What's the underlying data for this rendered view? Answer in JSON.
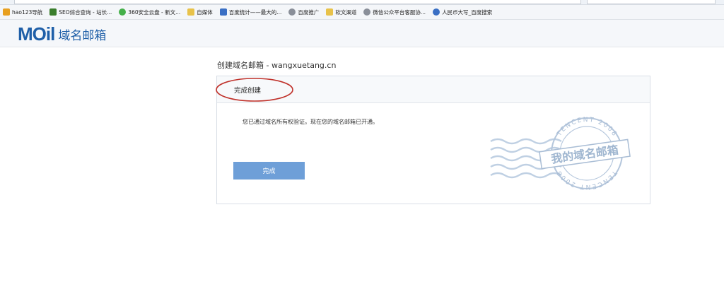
{
  "bookmarks": [
    {
      "label": "hao123导航",
      "icon": "hao123-icon",
      "color": "#e8a020"
    },
    {
      "label": "SEO综合查询 - 站长...",
      "icon": "seo-icon",
      "color": "#3a7d2c"
    },
    {
      "label": "360安全云盘 - 新文...",
      "icon": "cloud-icon",
      "color": "#45b04a"
    },
    {
      "label": "自媒体",
      "icon": "folder-icon",
      "color": "#e8c24a"
    },
    {
      "label": "百度统计——最大的...",
      "icon": "stats-icon",
      "color": "#3a6fc4"
    },
    {
      "label": "百度推广",
      "icon": "globe-icon",
      "color": "#8a8f99"
    },
    {
      "label": "软文渠道",
      "icon": "folder-icon",
      "color": "#e8c24a"
    },
    {
      "label": "微信公众平台客服协...",
      "icon": "globe-icon",
      "color": "#8a8f99"
    },
    {
      "label": "人民币大写_百度搜索",
      "icon": "paw-icon",
      "color": "#3a6fc4"
    }
  ],
  "header": {
    "logo_mark": "MOil",
    "logo_text": "域名邮箱"
  },
  "page": {
    "title": "创建域名邮箱 - wangxuetang.cn"
  },
  "card": {
    "header_title": "完成创建",
    "message": "您已通过域名所有权验证。现在您的域名邮箱已开通。",
    "button_label": "完成"
  },
  "stamp": {
    "center_text": "我的域名邮箱",
    "ring_text": "TENCENT 2008",
    "color": "#9fb6d0"
  },
  "colors": {
    "brand": "#1f5fa8",
    "button": "#6e9fd8",
    "annotation": "#c0322b"
  }
}
